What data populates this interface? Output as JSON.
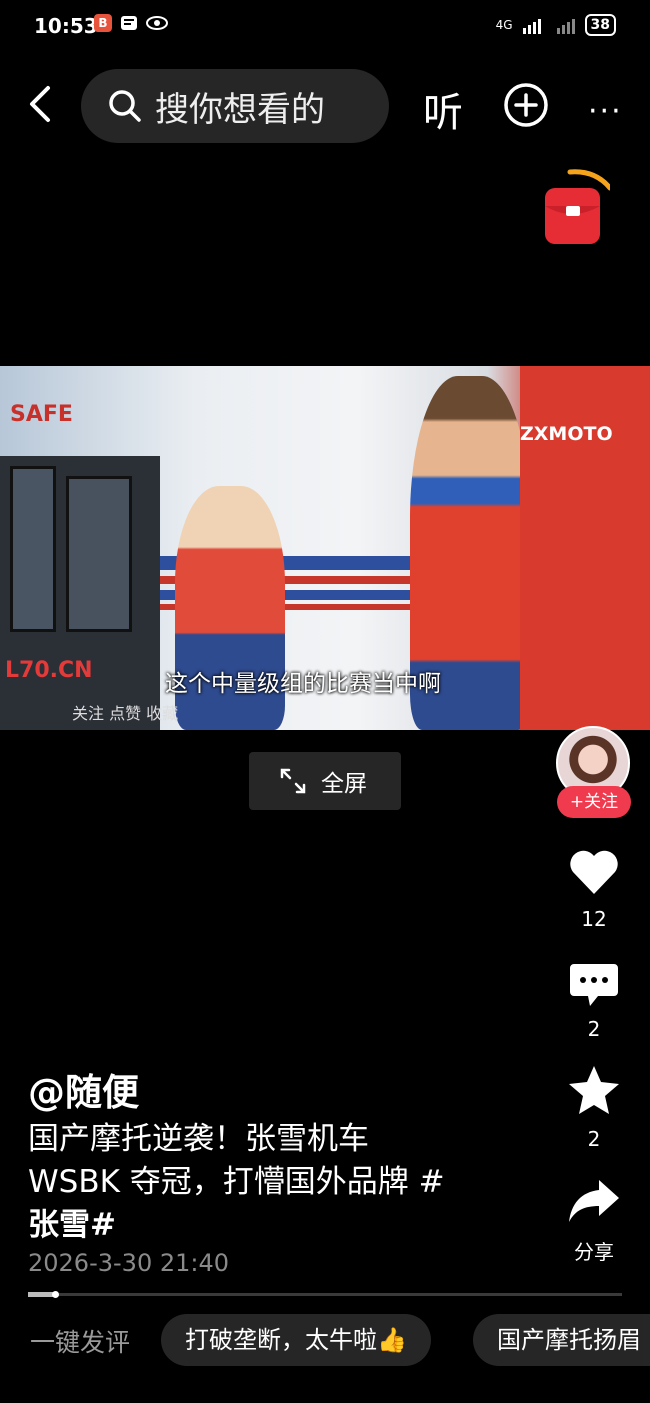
{
  "status": {
    "time": "10:53",
    "app_badge": "B",
    "network": "4G",
    "battery": "38"
  },
  "topbar": {
    "search_placeholder": "搜你想看的",
    "listen": "听",
    "more": "···"
  },
  "video": {
    "subtitle": "这个中量级组的比赛当中啊",
    "watermark": "L70.CN",
    "overlay": "关注 点赞 收藏",
    "logo_safe": "SAFE",
    "brand": "ZXMOTO"
  },
  "fullscreen": {
    "label": "全屏"
  },
  "side": {
    "follow": "+关注",
    "likes": "12",
    "comments": "2",
    "favorites": "2",
    "share": "分享"
  },
  "post": {
    "author": "@随便",
    "desc_line1": "国产摩托逆袭！张雪机车",
    "desc_line2": "WSBK 夺冠，打懵国外品牌 #",
    "desc_line3": "张雪#",
    "date": "2026-3-30 21:40"
  },
  "progress": 0.05,
  "quick_comment": {
    "label": "一键发评",
    "chips": [
      "打破垄断，太牛啦👍",
      "国产摩托扬眉"
    ]
  },
  "colors": {
    "accent": "#f03a4e",
    "bg": "#000000"
  }
}
